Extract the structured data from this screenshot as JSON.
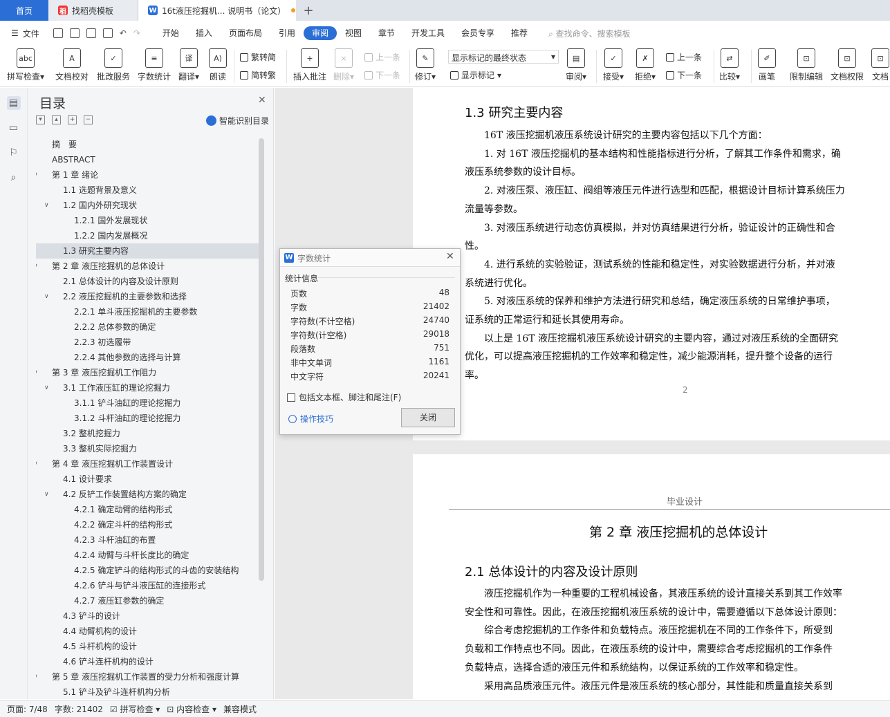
{
  "tabs": {
    "home": "首页",
    "doc1": "找稻壳模板",
    "doc2": "16t液压挖掘机... 说明书（论文）"
  },
  "menu": {
    "file": "文件",
    "items": [
      "开始",
      "插入",
      "页面布局",
      "引用",
      "审阅",
      "视图",
      "章节",
      "开发工具",
      "会员专享",
      "推荐"
    ],
    "active": "审阅",
    "search": "查找命令、搜索模板"
  },
  "ribbon": {
    "spell": "拼写检查",
    "proof": "文档校对",
    "batch": "批改服务",
    "wordcount": "字数统计",
    "translate": "翻译",
    "read": "朗读",
    "t2s": "繁转简",
    "s2t": "简转繁",
    "comment": "插入批注",
    "delete": "删除",
    "prev_c": "上一条",
    "next_c": "下一条",
    "revise": "修订",
    "markup_select": "显示标记的最终状态",
    "show_markup": "显示标记",
    "review": "审阅",
    "accept": "接受",
    "reject": "拒绝",
    "prev_r": "上一条",
    "next_r": "下一条",
    "compare": "比较",
    "pen": "画笔",
    "restrict": "限制编辑",
    "perm": "文档权限",
    "doc_more": "文档"
  },
  "toc": {
    "title": "目录",
    "smart": "智能识别目录",
    "items": [
      {
        "label": "摘　要",
        "level": 0,
        "chev": false
      },
      {
        "label": "ABSTRACT",
        "level": 0,
        "chev": false
      },
      {
        "label": "第 1 章  绪论",
        "level": 0,
        "chev": true
      },
      {
        "label": "1.1  选题背景及意义",
        "level": 1,
        "chev": false
      },
      {
        "label": "1.2  国内外研究现状",
        "level": 1,
        "chev": true
      },
      {
        "label": "1.2.1 国外发展现状",
        "level": 2,
        "chev": false
      },
      {
        "label": "1.2.2 国内发展概况",
        "level": 2,
        "chev": false
      },
      {
        "label": "1.3  研究主要内容",
        "level": 1,
        "chev": false,
        "sel": true
      },
      {
        "label": "第 2 章  液压挖掘机的总体设计",
        "level": 0,
        "chev": true
      },
      {
        "label": "2.1  总体设计的内容及设计原则",
        "level": 1,
        "chev": false
      },
      {
        "label": "2.2  液压挖掘机的主要参数和选择",
        "level": 1,
        "chev": true
      },
      {
        "label": "2.2.1  单斗液压挖掘机的主要参数",
        "level": 2,
        "chev": false
      },
      {
        "label": "2.2.2  总体参数的确定",
        "level": 2,
        "chev": false
      },
      {
        "label": "2.2.3 初选履带",
        "level": 2,
        "chev": false
      },
      {
        "label": "2.2.4 其他参数的选择与计算",
        "level": 2,
        "chev": false
      },
      {
        "label": "第 3 章  液压挖掘机工作阻力",
        "level": 0,
        "chev": true
      },
      {
        "label": "3.1  工作液压缸的理论挖掘力",
        "level": 1,
        "chev": true
      },
      {
        "label": "3.1.1 铲斗油缸的理论挖掘力",
        "level": 2,
        "chev": false
      },
      {
        "label": "3.1.2  斗杆油缸的理论挖掘力",
        "level": 2,
        "chev": false
      },
      {
        "label": "3.2  整机挖掘力",
        "level": 1,
        "chev": false
      },
      {
        "label": "3.3  整机实际挖掘力",
        "level": 1,
        "chev": false
      },
      {
        "label": "第 4 章  液压挖掘机工作装置设计",
        "level": 0,
        "chev": true
      },
      {
        "label": "4.1 设计要求",
        "level": 1,
        "chev": false
      },
      {
        "label": "4.2 反铲工作装置结构方案的确定",
        "level": 1,
        "chev": true
      },
      {
        "label": "4.2.1 确定动臂的结构形式",
        "level": 2,
        "chev": false
      },
      {
        "label": "4.2.2 确定斗杆的结构形式",
        "level": 2,
        "chev": false
      },
      {
        "label": "4.2.3 斗杆油缸的布置",
        "level": 2,
        "chev": false
      },
      {
        "label": "4.2.4 动臂与斗杆长度比的确定",
        "level": 2,
        "chev": false
      },
      {
        "label": "4.2.5 确定铲斗的结构形式的斗齿的安装结构",
        "level": 2,
        "chev": false
      },
      {
        "label": "4.2.6 铲斗与铲斗液压缸的连接形式",
        "level": 2,
        "chev": false
      },
      {
        "label": "4.2.7 液压缸参数的确定",
        "level": 2,
        "chev": false
      },
      {
        "label": "4.3  铲斗的设计",
        "level": 1,
        "chev": false
      },
      {
        "label": "4.4 动臂机构的设计",
        "level": 1,
        "chev": false
      },
      {
        "label": "4.5 斗杆机构的设计",
        "level": 1,
        "chev": false
      },
      {
        "label": "4.6  铲斗连杆机构的设计",
        "level": 1,
        "chev": false
      },
      {
        "label": "第 5 章  液压挖掘机工作装置的受力分析和强度计算",
        "level": 0,
        "chev": true
      },
      {
        "label": "5.1 铲斗及铲斗连杆机构分析",
        "level": 1,
        "chev": false
      }
    ]
  },
  "doc": {
    "p1_heading": "1.3  研究主要内容",
    "p1_lines": [
      "　　16T 液压挖掘机液压系统设计研究的主要内容包括以下几个方面：",
      "　　1. 对 16T 液压挖掘机的基本结构和性能指标进行分析，了解其工作条件和需求，确",
      "液压系统参数的设计目标。",
      "　　2. 对液压泵、液压缸、阀组等液压元件进行选型和匹配，根据设计目标计算系统压力",
      "流量等参数。",
      "　　3. 对液压系统进行动态仿真模拟，并对仿真结果进行分析，验证设计的正确性和合",
      "性。",
      "　　4. 进行系统的实验验证，测试系统的性能和稳定性，对实验数据进行分析，并对液",
      "系统进行优化。",
      "　　5. 对液压系统的保养和维护方法进行研究和总结，确定液压系统的日常维护事项，",
      "证系统的正常运行和延长其使用寿命。",
      "　　以上是 16T 液压挖掘机液压系统设计研究的主要内容，通过对液压系统的全面研究",
      "优化，可以提高液压挖掘机的工作效率和稳定性，减少能源消耗，提升整个设备的运行",
      "率。"
    ],
    "page_num": "2",
    "header": "毕业设计",
    "chapter": "第 2 章  液压挖掘机的总体设计",
    "p2_heading": "2.1  总体设计的内容及设计原则",
    "p2_lines": [
      "　　液压挖掘机作为一种重要的工程机械设备，其液压系统的设计直接关系到其工作效率",
      "安全性和可靠性。因此，在液压挖掘机液压系统的设计中，需要遵循以下总体设计原则：",
      "　　综合考虑挖掘机的工作条件和负载特点。液压挖掘机在不同的工作条件下，所受到",
      "负载和工作特点也不同。因此，在液压系统的设计中，需要综合考虑挖掘机的工作条件",
      "负载特点，选择合适的液压元件和系统结构，以保证系统的工作效率和稳定性。",
      "　　采用高品质液压元件。液压元件是液压系统的核心部分，其性能和质量直接关系到"
    ]
  },
  "dialog": {
    "title": "字数统计",
    "section": "统计信息",
    "stats": [
      {
        "k": "页数",
        "v": "48"
      },
      {
        "k": "字数",
        "v": "21402"
      },
      {
        "k": "字符数(不计空格)",
        "v": "24740"
      },
      {
        "k": "字符数(计空格)",
        "v": "29018"
      },
      {
        "k": "段落数",
        "v": "751"
      },
      {
        "k": "非中文单词",
        "v": "1161"
      },
      {
        "k": "中文字符",
        "v": "20241"
      }
    ],
    "checkbox": "包括文本框、脚注和尾注(F)",
    "tips": "操作技巧",
    "close": "关闭"
  },
  "status": {
    "page": "页面: 7/48",
    "words": "字数: 21402",
    "spell": "拼写检查",
    "content": "内容检查",
    "compat": "兼容模式"
  }
}
